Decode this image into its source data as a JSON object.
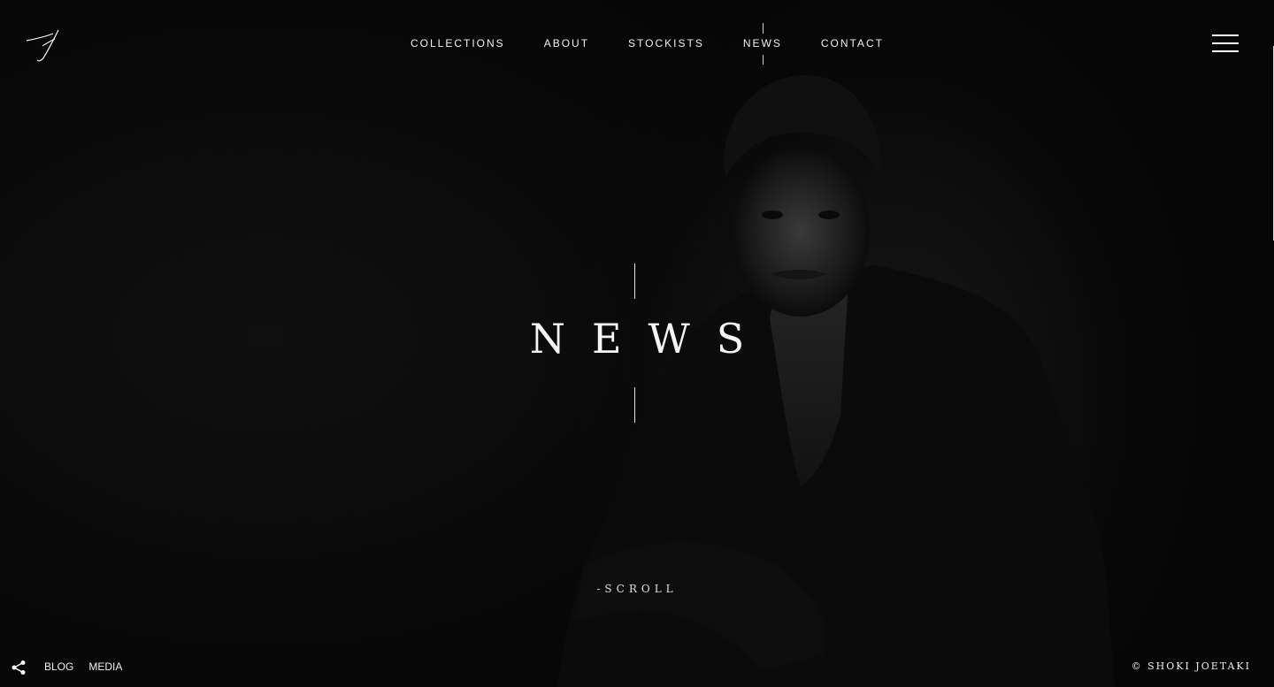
{
  "nav": {
    "items": [
      {
        "label": "COLLECTIONS"
      },
      {
        "label": "ABOUT"
      },
      {
        "label": "STOCKISTS"
      },
      {
        "label": "NEWS"
      },
      {
        "label": "CONTACT"
      }
    ],
    "active_index": 3
  },
  "hero": {
    "heading": "NEWS",
    "scroll_label": "-SCROLL"
  },
  "footer": {
    "links": [
      "BLOG",
      "MEDIA"
    ],
    "copyright": "© SHOKI JOETAKI"
  },
  "icons": {
    "logo": "signature-logo",
    "menu": "hamburger-icon",
    "share": "share-icon"
  },
  "colors": {
    "background": "#060606",
    "text": "#f5f5f5"
  }
}
